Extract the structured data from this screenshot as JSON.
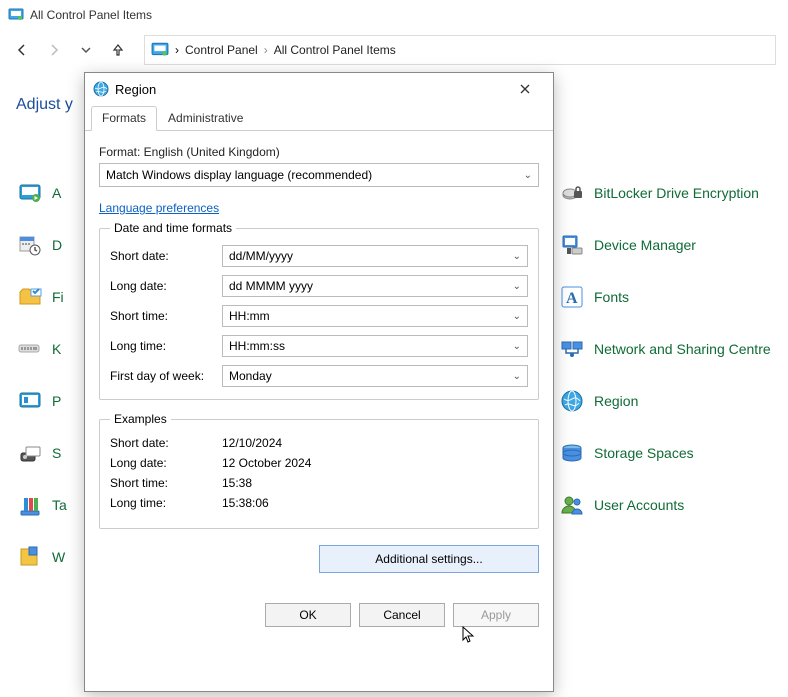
{
  "titlebar": {
    "text": "All Control Panel Items"
  },
  "breadcrumb": {
    "part1": "Control Panel",
    "part2": "All Control Panel Items"
  },
  "adjust_label": "Adjust y",
  "cp_left": [
    {
      "label": "A"
    },
    {
      "label": "D"
    },
    {
      "label": "Fi"
    },
    {
      "label": "K"
    },
    {
      "label": "P"
    },
    {
      "label": "S"
    },
    {
      "label": "Ta"
    },
    {
      "label": "W"
    }
  ],
  "cp_right": [
    {
      "label": "BitLocker Drive Encryption"
    },
    {
      "label": "Device Manager"
    },
    {
      "label": "Fonts"
    },
    {
      "label": "Network and Sharing Centre"
    },
    {
      "label": "Region"
    },
    {
      "label": "Storage Spaces"
    },
    {
      "label": "User Accounts"
    }
  ],
  "dialog": {
    "title": "Region",
    "tabs": {
      "formats": "Formats",
      "admin": "Administrative"
    },
    "format_label": "Format: English (United Kingdom)",
    "format_select": "Match Windows display language (recommended)",
    "lang_pref": "Language preferences",
    "group1": "Date and time formats",
    "fields": {
      "short_date": {
        "label": "Short date:",
        "value": "dd/MM/yyyy"
      },
      "long_date": {
        "label": "Long date:",
        "value": "dd MMMM yyyy"
      },
      "short_time": {
        "label": "Short time:",
        "value": "HH:mm"
      },
      "long_time": {
        "label": "Long time:",
        "value": "HH:mm:ss"
      },
      "first_day": {
        "label": "First day of week:",
        "value": "Monday"
      }
    },
    "group2": "Examples",
    "examples": {
      "short_date": {
        "label": "Short date:",
        "value": "12/10/2024"
      },
      "long_date": {
        "label": "Long date:",
        "value": "12 October 2024"
      },
      "short_time": {
        "label": "Short time:",
        "value": "15:38"
      },
      "long_time": {
        "label": "Long time:",
        "value": "15:38:06"
      }
    },
    "additional": "Additional settings...",
    "ok": "OK",
    "cancel": "Cancel",
    "apply": "Apply"
  }
}
